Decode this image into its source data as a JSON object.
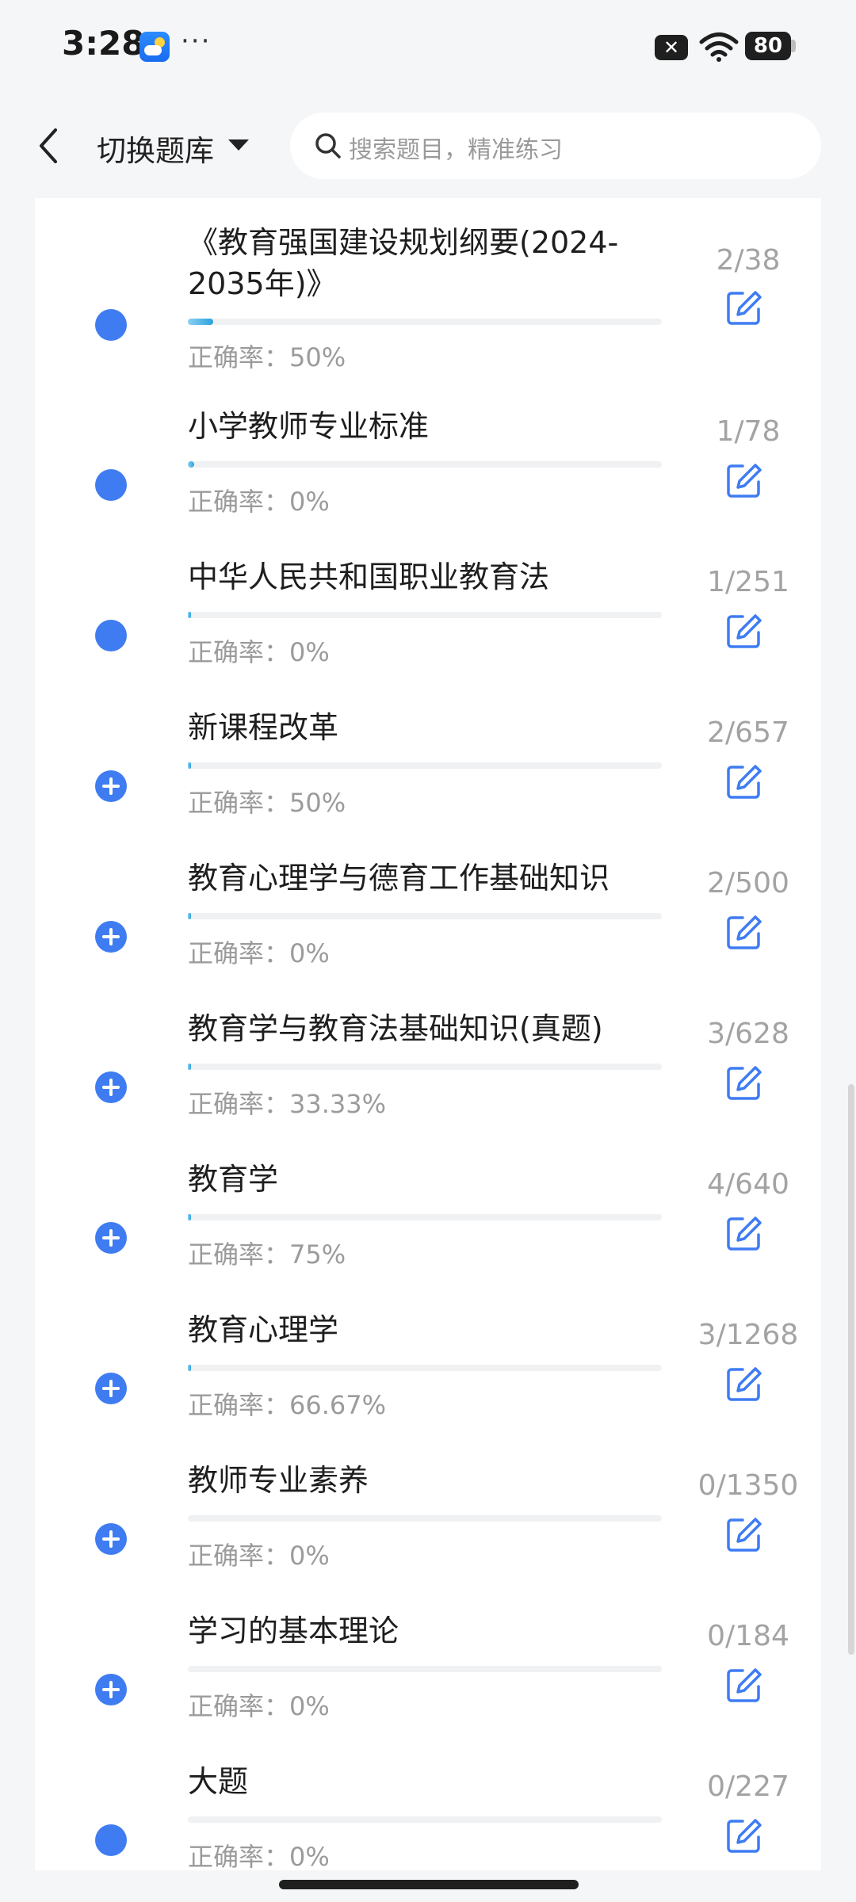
{
  "status": {
    "time": "3:28",
    "battery": "80",
    "x_glyph": "✕",
    "more": "···"
  },
  "header": {
    "title": "切换题库",
    "search_placeholder": "搜索题目，精准练习"
  },
  "items": [
    {
      "title": "《教育强国建设规划纲要(2024-2035年)》",
      "accuracy": "正确率：50%",
      "count": "2/38",
      "progress": 0.053,
      "icon": "dot"
    },
    {
      "title": "小学教师专业标准",
      "accuracy": "正确率：0%",
      "count": "1/78",
      "progress": 0.013,
      "icon": "dot"
    },
    {
      "title": "中华人民共和国职业教育法",
      "accuracy": "正确率：0%",
      "count": "1/251",
      "progress": 0.004,
      "icon": "dot"
    },
    {
      "title": "新课程改革",
      "accuracy": "正确率：50%",
      "count": "2/657",
      "progress": 0.003,
      "icon": "plus"
    },
    {
      "title": "教育心理学与德育工作基础知识",
      "accuracy": "正确率：0%",
      "count": "2/500",
      "progress": 0.004,
      "icon": "plus"
    },
    {
      "title": "教育学与教育法基础知识(真题)",
      "accuracy": "正确率：33.33%",
      "count": "3/628",
      "progress": 0.005,
      "icon": "plus"
    },
    {
      "title": "教育学",
      "accuracy": "正确率：75%",
      "count": "4/640",
      "progress": 0.006,
      "icon": "plus"
    },
    {
      "title": "教育心理学",
      "accuracy": "正确率：66.67%",
      "count": "3/1268",
      "progress": 0.002,
      "icon": "plus"
    },
    {
      "title": "教师专业素养",
      "accuracy": "正确率：0%",
      "count": "0/1350",
      "progress": 0,
      "icon": "plus"
    },
    {
      "title": "学习的基本理论",
      "accuracy": "正确率：0%",
      "count": "0/184",
      "progress": 0,
      "icon": "plus"
    },
    {
      "title": "大题",
      "accuracy": "正确率：0%",
      "count": "0/227",
      "progress": 0,
      "icon": "dot"
    }
  ]
}
